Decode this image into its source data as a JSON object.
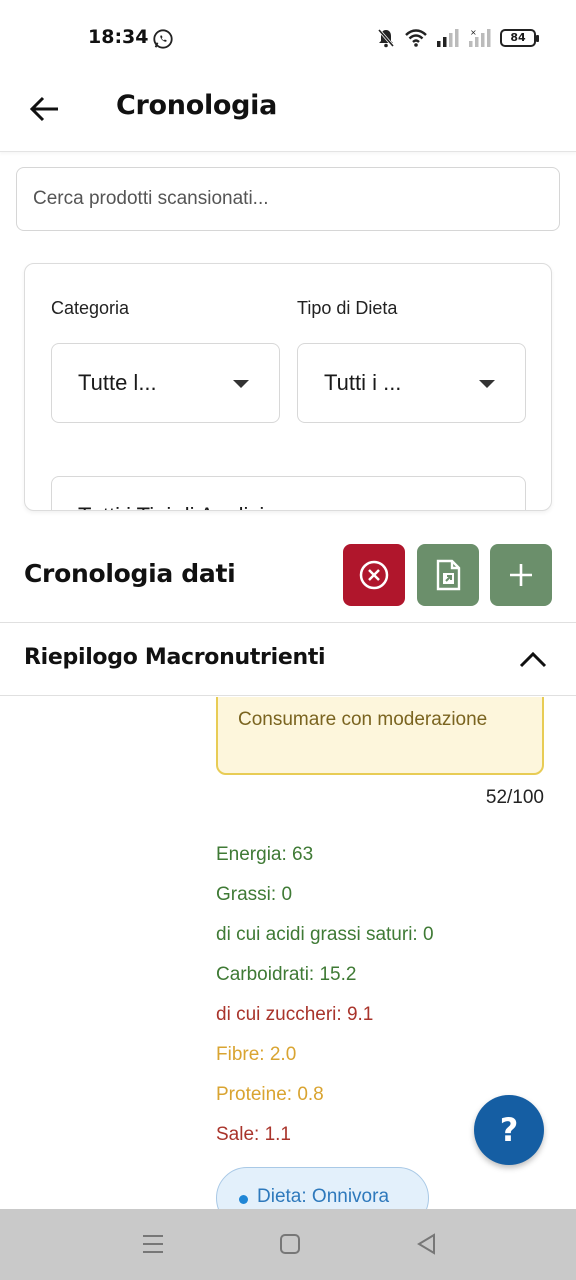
{
  "status_bar": {
    "time": "18:34",
    "battery": "84",
    "icons": [
      "whatsapp-icon",
      "bell-off-icon",
      "wifi-icon",
      "signal-icon",
      "signal-icon",
      "battery-icon"
    ]
  },
  "app_bar": {
    "title": "Cronologia",
    "back_icon": "arrow-left-icon"
  },
  "search": {
    "placeholder": "Cerca prodotti scansionati..."
  },
  "filters": {
    "category_label": "Categoria",
    "category_value": "Tutte l...",
    "diet_label": "Tipo di Dieta",
    "diet_value": "Tutti i ...",
    "analysis_value": "Tutti i Tipi di Analisi"
  },
  "history": {
    "title": "Cronologia dati",
    "buttons": [
      "clear-icon",
      "export-icon",
      "add-icon"
    ]
  },
  "macro_summary": {
    "title": "Riepilogo Macronutrienti",
    "chevron": "chevron-up-icon"
  },
  "product": {
    "warning": "Consumare con moderazione",
    "score": "52/100",
    "nutrients": [
      {
        "text": "Energia: 63",
        "level": "good"
      },
      {
        "text": "Grassi: 0",
        "level": "good"
      },
      {
        "text": "di cui acidi grassi saturi: 0",
        "level": "good"
      },
      {
        "text": "Carboidrati: 15.2",
        "level": "good"
      },
      {
        "text": "di cui zuccheri: 9.1",
        "level": "bad"
      },
      {
        "text": "Fibre: 2.0",
        "level": "medium"
      },
      {
        "text": "Proteine: 0.8",
        "level": "medium"
      },
      {
        "text": "Sale: 1.1",
        "level": "bad"
      }
    ],
    "diet_chip": "Dieta: Onnivora"
  },
  "help_button": "?",
  "colors": {
    "danger": "#b0162c",
    "primary_green": "#6b8f6b",
    "good": "#3f7a35",
    "bad": "#a9342b",
    "medium": "#d9a431",
    "help_blue": "#155ea3"
  }
}
